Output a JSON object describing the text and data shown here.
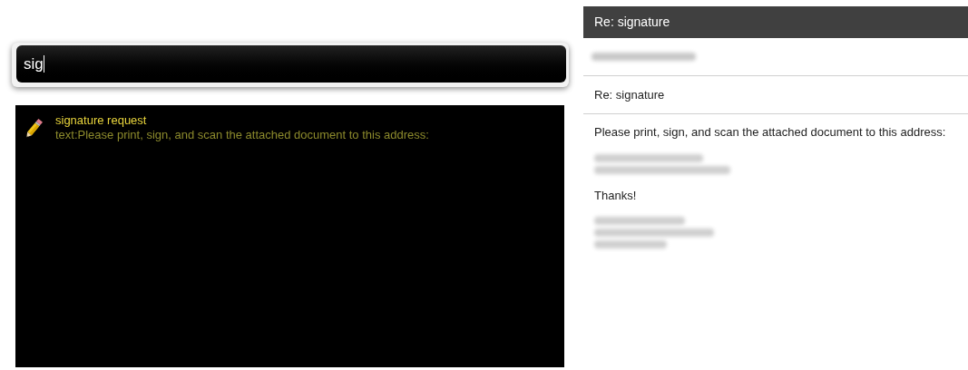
{
  "search": {
    "value": "sig"
  },
  "results": [
    {
      "title": "signature request",
      "preview": "text:Please print, sign, and scan the attached document to this address:",
      "selected": false
    }
  ],
  "email": {
    "header": "Re: signature",
    "subject": "Re: signature",
    "body": [
      {
        "kind": "text",
        "text": "Please print, sign, and scan the attached document to this address:"
      },
      {
        "kind": "redacted"
      },
      {
        "kind": "text",
        "text": "Thanks!"
      },
      {
        "kind": "redacted"
      }
    ]
  }
}
